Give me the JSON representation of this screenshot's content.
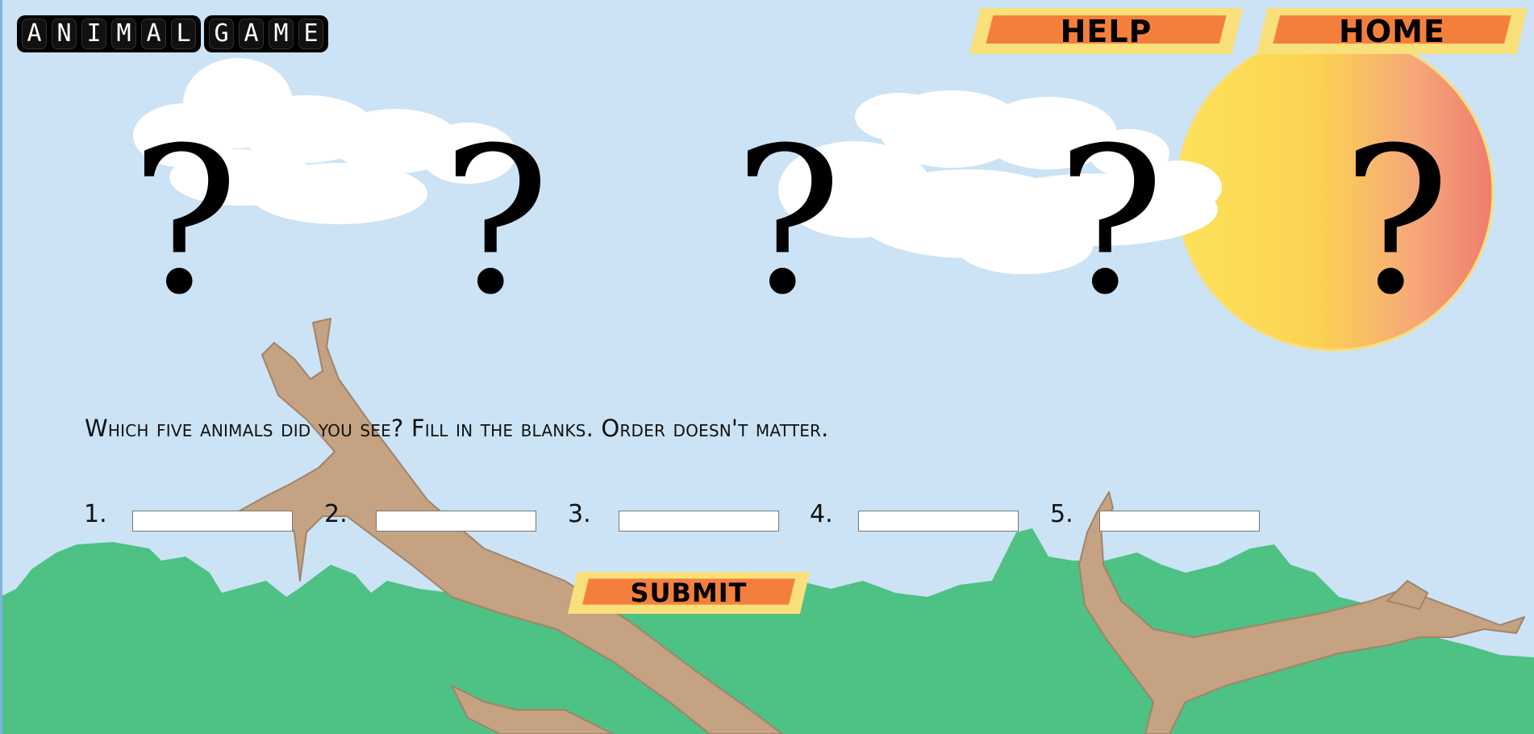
{
  "app": {
    "title_words": [
      [
        "A",
        "N",
        "I",
        "M",
        "A",
        "L"
      ],
      [
        "G",
        "A",
        "M",
        "E"
      ]
    ]
  },
  "nav": {
    "help_label": "HELP",
    "home_label": "HOME"
  },
  "hidden_animals": [
    "?",
    "?",
    "?",
    "?",
    "?"
  ],
  "instruction": "Which five animals did you see? Fill in the blanks. Order doesn't matter.",
  "answers": [
    {
      "number": "1.",
      "value": ""
    },
    {
      "number": "2.",
      "value": ""
    },
    {
      "number": "3.",
      "value": ""
    },
    {
      "number": "4.",
      "value": ""
    },
    {
      "number": "5.",
      "value": ""
    }
  ],
  "submit_label": "SUBMIT",
  "colors": {
    "sky": "#cbe3f5",
    "button_outer": "#f9e07a",
    "button_inner": "#f47f3d",
    "bush": "#4ec184",
    "branch": "#c4a282",
    "sun_left": "#fde25a",
    "sun_right": "#ef7c6f"
  }
}
